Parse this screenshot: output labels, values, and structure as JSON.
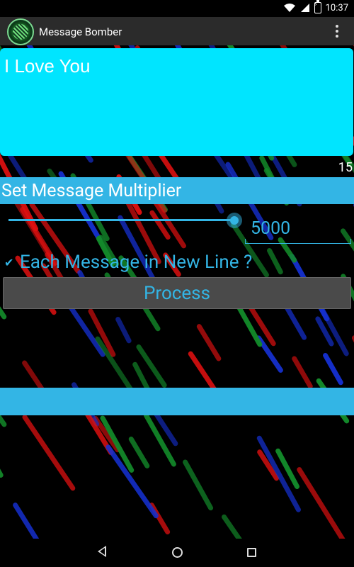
{
  "status_bar": {
    "time": "10:37"
  },
  "action_bar": {
    "title": "Message Bomber"
  },
  "message": {
    "text": "I Love You",
    "char_count": "15"
  },
  "multiplier": {
    "header": "Set Message Multiplier",
    "value": "5000",
    "slider_fraction": 1.0
  },
  "options": {
    "new_line_label": "Each Message in New Line ?",
    "new_line_checked": true
  },
  "actions": {
    "process_label": "Process"
  },
  "colors": {
    "accent": "#33b5e5",
    "message_bg": "#00e5ff",
    "action_bar_bg": "#2b2b2b",
    "button_bg": "#4a4a4a"
  }
}
